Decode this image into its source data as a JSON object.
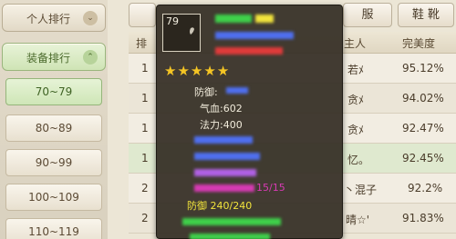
{
  "sidebar": {
    "tabs": [
      {
        "label": "个人排行",
        "chevron": "⌄"
      },
      {
        "label": "装备排行",
        "chevron": "⌃"
      }
    ],
    "ranges": [
      "70~79",
      "80~89",
      "90~99",
      "100~109",
      "110~119"
    ],
    "selected_index": 0
  },
  "top_tabs": [
    "服",
    "鞋 靴"
  ],
  "table": {
    "headers": {
      "rank": "排",
      "owner": "主人",
      "perfection": "完美度"
    },
    "rows": [
      {
        "rank": "1",
        "owner": "若ﾒ",
        "perfection": "95.12%"
      },
      {
        "rank": "1",
        "owner": "贪ﾒ",
        "perfection": "94.02%"
      },
      {
        "rank": "1",
        "owner": "贪ﾒ",
        "perfection": "92.47%"
      },
      {
        "rank": "1",
        "owner": "忆。",
        "perfection": "92.45%"
      },
      {
        "rank": "2",
        "owner": "丶混子",
        "perfection": "92.2%"
      },
      {
        "rank": "2",
        "owner": "晴☆'",
        "perfection": "91.83%"
      }
    ]
  },
  "tooltip": {
    "level": "79",
    "star_count": 5,
    "defense": "防御:",
    "hp": "气血:602",
    "mana": "法力:400",
    "bonus": "防御 240/240",
    "special": "15/15",
    "colors": {
      "base": "#f2ecdc",
      "green": "#3fd04a",
      "blue": "#4f6ff0",
      "red": "#e03b3b",
      "purple": "#b061e4",
      "magenta": "#d83ab4",
      "yellow": "#f2e43c",
      "star": "#f5c524"
    }
  }
}
